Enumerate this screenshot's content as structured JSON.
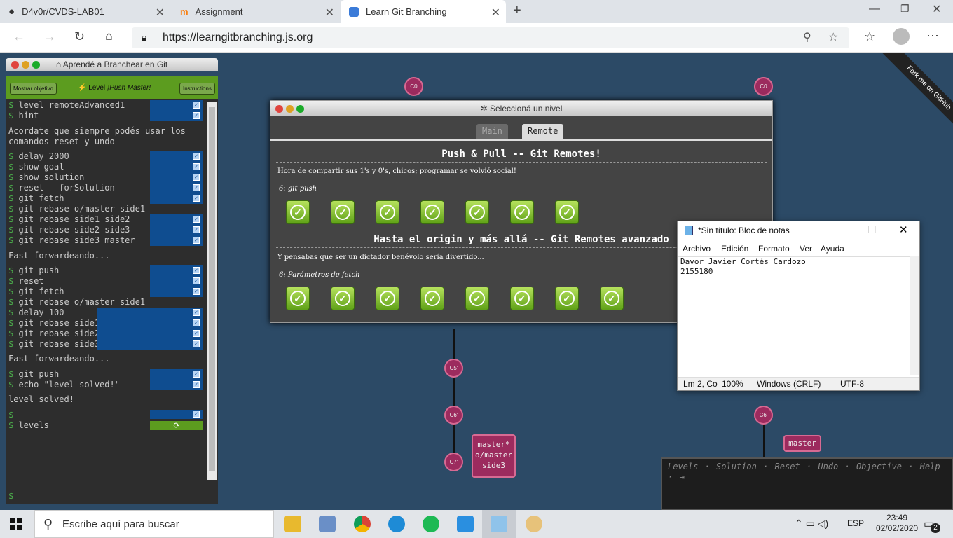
{
  "browser": {
    "tabs": [
      {
        "title": "D4v0r/CVDS-LAB01"
      },
      {
        "title": "Assignment"
      },
      {
        "title": "Learn Git Branching"
      }
    ],
    "url": "https://learngitbranching.js.org"
  },
  "app": {
    "window_title": "Aprendé a Branchear en Git",
    "show_goal_label": "Mostrar objetivo",
    "level_prefix": "Level",
    "level_name": "¡Push Master!",
    "instructions_label": "Instructions",
    "fork_ribbon": "Fork me on GitHub"
  },
  "terminal": {
    "lines": [
      {
        "cmd": "level remoteAdvanced1"
      },
      {
        "cmd": "hint"
      },
      {
        "text": "Acordate que siempre podés usar los"
      },
      {
        "text": "comandos reset y undo"
      },
      {
        "cmd": "delay 2000"
      },
      {
        "cmd": "show goal"
      },
      {
        "cmd": "show solution"
      },
      {
        "cmd": "reset --forSolution"
      },
      {
        "cmd": "git fetch"
      },
      {
        "cmd": "git rebase o/master side1"
      },
      {
        "cmd": "git rebase side1 side2"
      },
      {
        "cmd": "git rebase side2 side3"
      },
      {
        "cmd": "git rebase side3 master"
      },
      {
        "text": "Fast forwardeando..."
      },
      {
        "cmd": "git push"
      },
      {
        "cmd": "reset"
      },
      {
        "cmd": "git fetch"
      },
      {
        "cmd": "git rebase o/master side1"
      },
      {
        "cmd": "delay 100"
      },
      {
        "cmd": "git rebase side1 side2"
      },
      {
        "cmd": "git rebase side2 side3"
      },
      {
        "cmd": "git rebase side3 master"
      },
      {
        "text": "Fast forwardeando..."
      },
      {
        "cmd": "git push"
      },
      {
        "cmd": "echo \"level solved!\""
      },
      {
        "text": "level solved!"
      },
      {
        "cmd": ""
      },
      {
        "cmd": "levels"
      }
    ],
    "prompt": "$"
  },
  "graph": {
    "left_nodes": [
      "C0",
      "C5'",
      "C6'",
      "C7'"
    ],
    "left_branch_labels": [
      "master*",
      "o/master",
      "side3"
    ],
    "right_nodes": [
      "C0",
      "C6'"
    ],
    "right_branch_label": "master"
  },
  "level_dialog": {
    "title": "Seleccioná un nivel",
    "tabs": [
      "Main",
      "Remote"
    ],
    "active_tab": "Remote",
    "sections": [
      {
        "title": "Push & Pull -- Git Remotes!",
        "description": "Hora de compartir sus 1's y 0's, chicos; programar se volvió social!",
        "level_label": "6: git push",
        "level_count": 7,
        "solved_count": 7
      },
      {
        "title": "Hasta el origin y más allá -- Git Remotes avanzado",
        "description": "Y pensabas que ser un dictador benévolo sería divertido...",
        "level_label": "6: Parámetros de fetch",
        "level_count": 8,
        "solved_count": 8
      }
    ]
  },
  "notepad": {
    "title": "*Sin título: Bloc de notas",
    "menu": [
      "Archivo",
      "Edición",
      "Formato",
      "Ver",
      "Ayuda"
    ],
    "content_line1": "Davor Javier Cortés Cardozo",
    "content_line2": "2155180",
    "status": {
      "position": "Lm 2, Co",
      "zoom": "100%",
      "eol": "Windows (CRLF)",
      "encoding": "UTF-8"
    }
  },
  "command_bar": {
    "items": [
      "Levels",
      "Solution",
      "Reset",
      "Undo",
      "Objective",
      "Help"
    ]
  },
  "taskbar": {
    "search_placeholder": "Escribe aquí para buscar",
    "language": "ESP",
    "time": "23:49",
    "date": "02/02/2020",
    "notifications": "2"
  },
  "colors": {
    "accent_green": "#5c9c1f",
    "node": "#9c2b5e",
    "canvas": "#2c4a66"
  }
}
